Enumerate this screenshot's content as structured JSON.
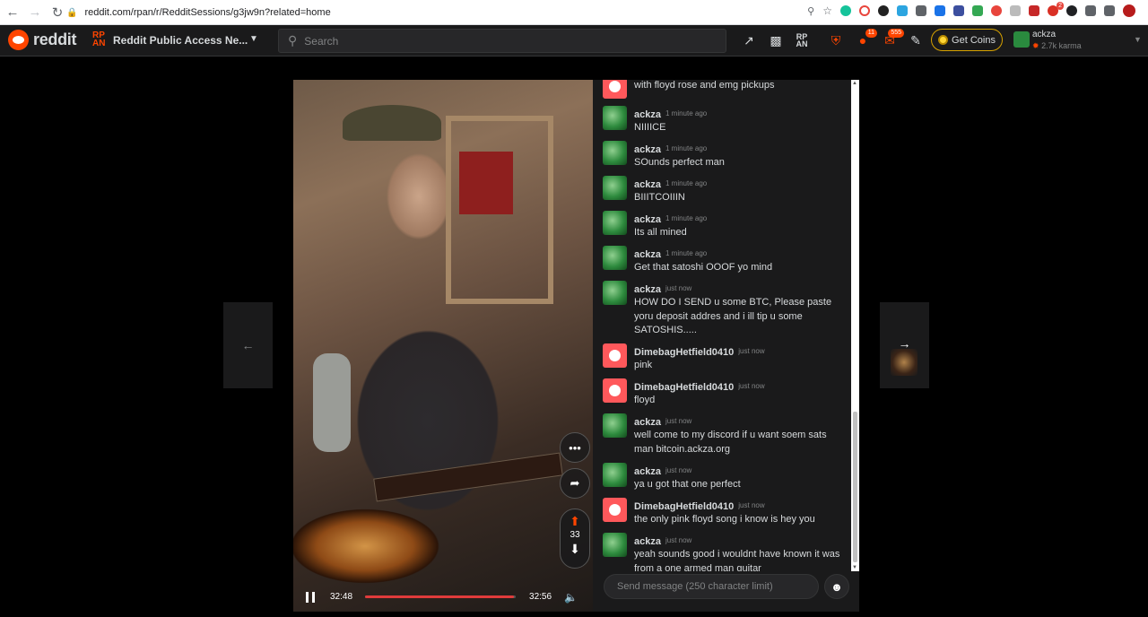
{
  "browser": {
    "url": "reddit.com/rpan/r/RedditSessions/g3jw9n?related=home",
    "back_icon": "arrow-left-icon",
    "forward_icon": "arrow-right-icon",
    "reload_icon": "reload-icon",
    "ext_badges": {
      "ext1": "11",
      "ext2": "2"
    }
  },
  "header": {
    "logo_text": "reddit",
    "community_name": "Reddit Public Access Ne...",
    "search_placeholder": "Search",
    "notif_badge_chat": "11",
    "notif_badge_mail": "555",
    "coins_label": "Get Coins",
    "user_name": "ackza",
    "user_karma": "2.7k karma"
  },
  "video": {
    "current_time": "32:48",
    "total_time": "32:56",
    "progress": 0.985,
    "vote_count": "33"
  },
  "chat": {
    "messages": [
      {
        "user": "",
        "time": "",
        "text": "with floyd rose and emg pickups",
        "avatar": "dime"
      },
      {
        "user": "ackza",
        "time": "1 minute ago",
        "text": "NIIIICE",
        "avatar": "ackza"
      },
      {
        "user": "ackza",
        "time": "1 minute ago",
        "text": "SOunds perfect man",
        "avatar": "ackza"
      },
      {
        "user": "ackza",
        "time": "1 minute ago",
        "text": "BIIITCOIIIN",
        "avatar": "ackza"
      },
      {
        "user": "ackza",
        "time": "1 minute ago",
        "text": "Its all mined",
        "avatar": "ackza"
      },
      {
        "user": "ackza",
        "time": "1 minute ago",
        "text": "Get that satoshi OOOF yo mind",
        "avatar": "ackza"
      },
      {
        "user": "ackza",
        "time": "just now",
        "text": "HOW DO I SEND u some BTC, Please paste yoru deposit addres and i ill tip u some SATOSHIS.....",
        "avatar": "ackza"
      },
      {
        "user": "DimebagHetfield0410",
        "time": "just now",
        "text": "pink",
        "avatar": "dime"
      },
      {
        "user": "DimebagHetfield0410",
        "time": "just now",
        "text": "floyd",
        "avatar": "dime"
      },
      {
        "user": "ackza",
        "time": "just now",
        "text": "well come to my discord if u want soem sats man bitcoin.ackza.org",
        "avatar": "ackza"
      },
      {
        "user": "ackza",
        "time": "just now",
        "text": "ya u got that one perfect",
        "avatar": "ackza"
      },
      {
        "user": "DimebagHetfield0410",
        "time": "just now",
        "text": "the only pink floyd song i know is hey you",
        "avatar": "dime"
      },
      {
        "user": "ackza",
        "time": "just now",
        "text": "yeah sounds good i wouldnt have known it was from a one armed man guitar",
        "avatar": "ackza"
      }
    ],
    "input_placeholder": "Send message (250 character limit)"
  },
  "colors": {
    "accent": "#ff4500",
    "background": "#1a1a1b",
    "text": "#d7dadc",
    "muted": "#818384"
  }
}
